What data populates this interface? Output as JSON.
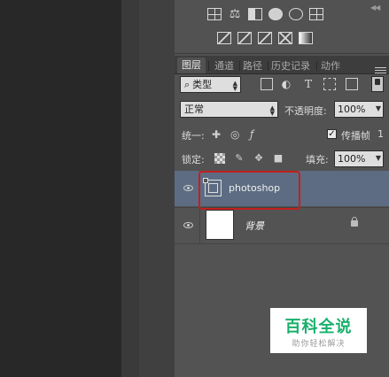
{
  "adjustments": {
    "row1": [
      "brightness-icon",
      "levels-icon",
      "curves-icon",
      "exposure-icon",
      "vibrance-icon",
      "huesat-icon"
    ],
    "row2": [
      "photo-filter-icon",
      "channel-mixer-icon",
      "gradient-map-icon",
      "selective-color-icon",
      "threshold-icon"
    ]
  },
  "layers_panel": {
    "tabs": [
      "图层",
      "通道",
      "路径",
      "历史记录",
      "动作"
    ],
    "collapse_glyph": "◀◀",
    "filter": {
      "kind_label": "类型",
      "search_glyph": "⌕"
    },
    "blend_mode": "正常",
    "opacity_label": "不透明度:",
    "opacity_value": "100%",
    "unify_label": "统一:",
    "propagate_label": "传播帧",
    "propagate_value": "1",
    "propagate_checked": "✓",
    "lock_label": "锁定:",
    "fill_label": "填充:",
    "fill_value": "100%",
    "layers": [
      {
        "name": "photoshop",
        "type": "smart-object",
        "selected": true
      },
      {
        "name": "背景",
        "type": "background",
        "locked": true
      }
    ]
  },
  "watermark": {
    "title": "百科全说",
    "subtitle": "助你轻松解决"
  },
  "colors": {
    "selection": "#5d6c82",
    "highlight": "#c0211f",
    "brand": "#18b06b"
  }
}
